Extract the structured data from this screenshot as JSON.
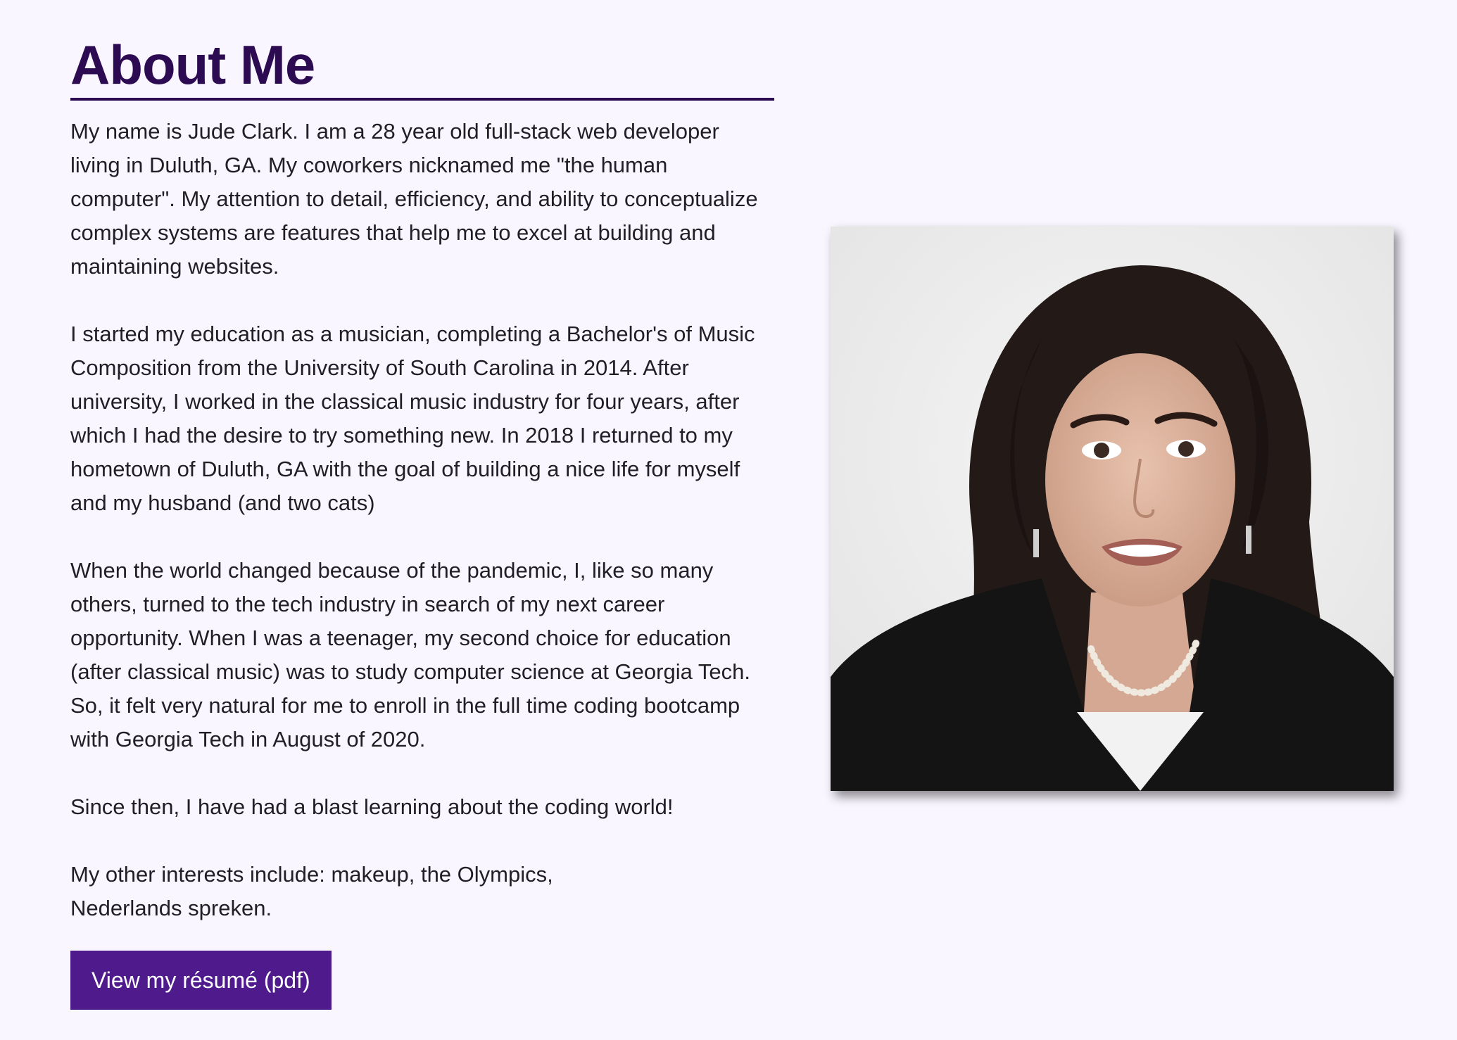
{
  "about": {
    "title": "About Me",
    "paragraphs": [
      "My name is Jude Clark. I am a 28 year old full-stack web developer living in Duluth, GA. My coworkers nicknamed me \"the human computer\". My attention to detail, efficiency, and ability to conceptualize complex systems are features that help me to excel at building and maintaining websites.",
      "I started my education as a musician, completing a Bachelor's of Music Composition from the University of South Carolina in 2014. After university, I worked in the classical music industry for four years, after which I had the desire to try something new. In 2018 I returned to my hometown of Duluth, GA with the goal of building a nice life for myself and my husband (and two cats)",
      "When the world changed because of the pandemic, I, like so many others, turned to the tech industry in search of my next career opportunity. When I was a teenager, my second choice for education (after classical music) was to study computer science at Georgia Tech. So, it felt very natural for me to enroll in the full time coding bootcamp with Georgia Tech in August of 2020.",
      "Since then, I have had a blast learning about the coding world!",
      "My other interests include: makeup, the Olympics,",
      "Nederlands spreken."
    ],
    "resume_button": "View my résumé (pdf)"
  },
  "photo": {
    "icon": "portrait-photo",
    "background_color": "#e9e9e9"
  },
  "colors": {
    "page_background": "#f9f6ff",
    "heading": "#2d0b52",
    "button": "#4f1a8c",
    "text": "#1f1f24"
  }
}
